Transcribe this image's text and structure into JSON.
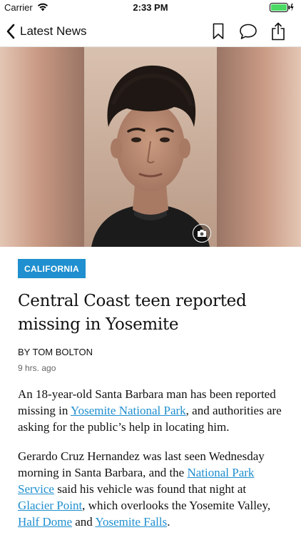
{
  "status_bar": {
    "carrier": "Carrier",
    "time": "2:33 PM"
  },
  "nav": {
    "back_label": "Latest News"
  },
  "article": {
    "section": "CALIFORNIA",
    "headline": "Central Coast teen reported missing in Yosemite",
    "byline": "BY TOM BOLTON",
    "timestamp": "9 hrs. ago",
    "p1": {
      "t1": "An 18-year-old Santa Barbara man has been reported missing in ",
      "link1": "Yosemite National Park",
      "t2": ", and authorities are asking for the public’s help in locating him."
    },
    "p2": {
      "t1": "Gerardo Cruz Hernandez was last seen Wednesday morning in Santa Barbara, and the ",
      "link1": "National Park Service",
      "t2": " said his vehicle was found that night at ",
      "link2": "Glacier Point",
      "t3": ", which overlooks the Yosemite Valley, ",
      "link3": "Half Dome",
      "t4": " and ",
      "link4": "Yosemite Falls",
      "t5": "."
    }
  },
  "colors": {
    "accent": "#1f8fcf",
    "battery": "#4cd964"
  }
}
